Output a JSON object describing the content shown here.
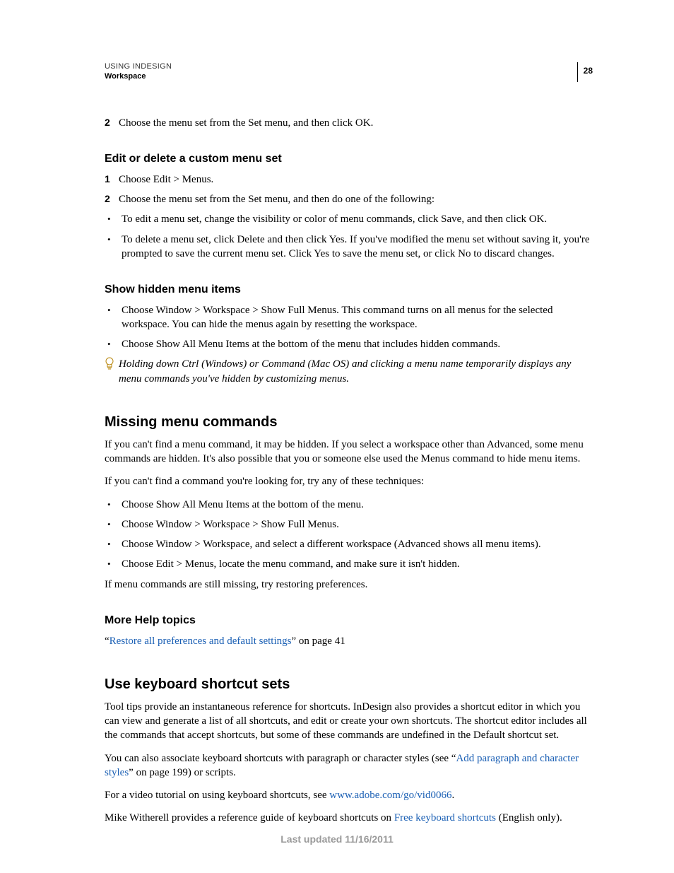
{
  "header": {
    "title": "USING INDESIGN",
    "subtitle": "Workspace",
    "page_number": "28"
  },
  "step2_intro": {
    "num": "2",
    "text": "Choose the menu set from the Set menu, and then click OK."
  },
  "section_edit": {
    "heading": "Edit or delete a custom menu set",
    "steps": [
      {
        "num": "1",
        "text": "Choose Edit > Menus."
      },
      {
        "num": "2",
        "text": "Choose the menu set from the Set menu, and then do one of the following:"
      }
    ],
    "bullets": [
      "To edit a menu set, change the visibility or color of menu commands, click Save, and then click OK.",
      "To delete a menu set, click Delete and then click Yes. If you've modified the menu set without saving it, you're prompted to save the current menu set. Click Yes to save the menu set, or click No to discard changes."
    ]
  },
  "section_show": {
    "heading": "Show hidden menu items",
    "bullets": [
      "Choose Window > Workspace > Show Full Menus. This command turns on all menus for the selected workspace. You can hide the menus again by resetting the workspace.",
      "Choose Show All Menu Items at the bottom of the menu that includes hidden commands."
    ],
    "tip": "Holding down Ctrl (Windows) or Command (Mac OS) and clicking a menu name temporarily displays any menu commands you've hidden by customizing menus."
  },
  "section_missing": {
    "heading": "Missing menu commands",
    "p1": "If you can't find a menu command, it may be hidden. If you select a workspace other than Advanced, some menu commands are hidden. It's also possible that you or someone else used the Menus command to hide menu items.",
    "p2": "If you can't find a command you're looking for, try any of these techniques:",
    "bullets": [
      "Choose Show All Menu Items at the bottom of the menu.",
      "Choose Window > Workspace > Show Full Menus.",
      "Choose Window > Workspace, and select a different workspace (Advanced shows all menu items).",
      "Choose Edit > Menus, locate the menu command, and make sure it isn't hidden."
    ],
    "p3": "If menu commands are still missing, try restoring preferences."
  },
  "section_morehelp": {
    "heading": "More Help topics",
    "quote_open": "“",
    "link_text": "Restore all preferences and default settings",
    "quote_close": "” on page 41"
  },
  "section_keyboard": {
    "heading": "Use keyboard shortcut sets",
    "p1": "Tool tips provide an instantaneous reference for shortcuts. InDesign also provides a shortcut editor in which you can view and generate a list of all shortcuts, and edit or create your own shortcuts. The shortcut editor includes all the commands that accept shortcuts, but some of these commands are undefined in the Default shortcut set.",
    "p2_a": "You can also associate keyboard shortcuts with paragraph or character styles (see “",
    "p2_link": "Add paragraph and character styles",
    "p2_b": "” on page 199) or scripts.",
    "p3_a": "For a video tutorial on using keyboard shortcuts, see ",
    "p3_link": "www.adobe.com/go/vid0066",
    "p3_b": ".",
    "p4_a": "Mike Witherell provides a reference guide of keyboard shortcuts on ",
    "p4_link": "Free keyboard shortcuts",
    "p4_b": " (English only)."
  },
  "footer": "Last updated 11/16/2011"
}
